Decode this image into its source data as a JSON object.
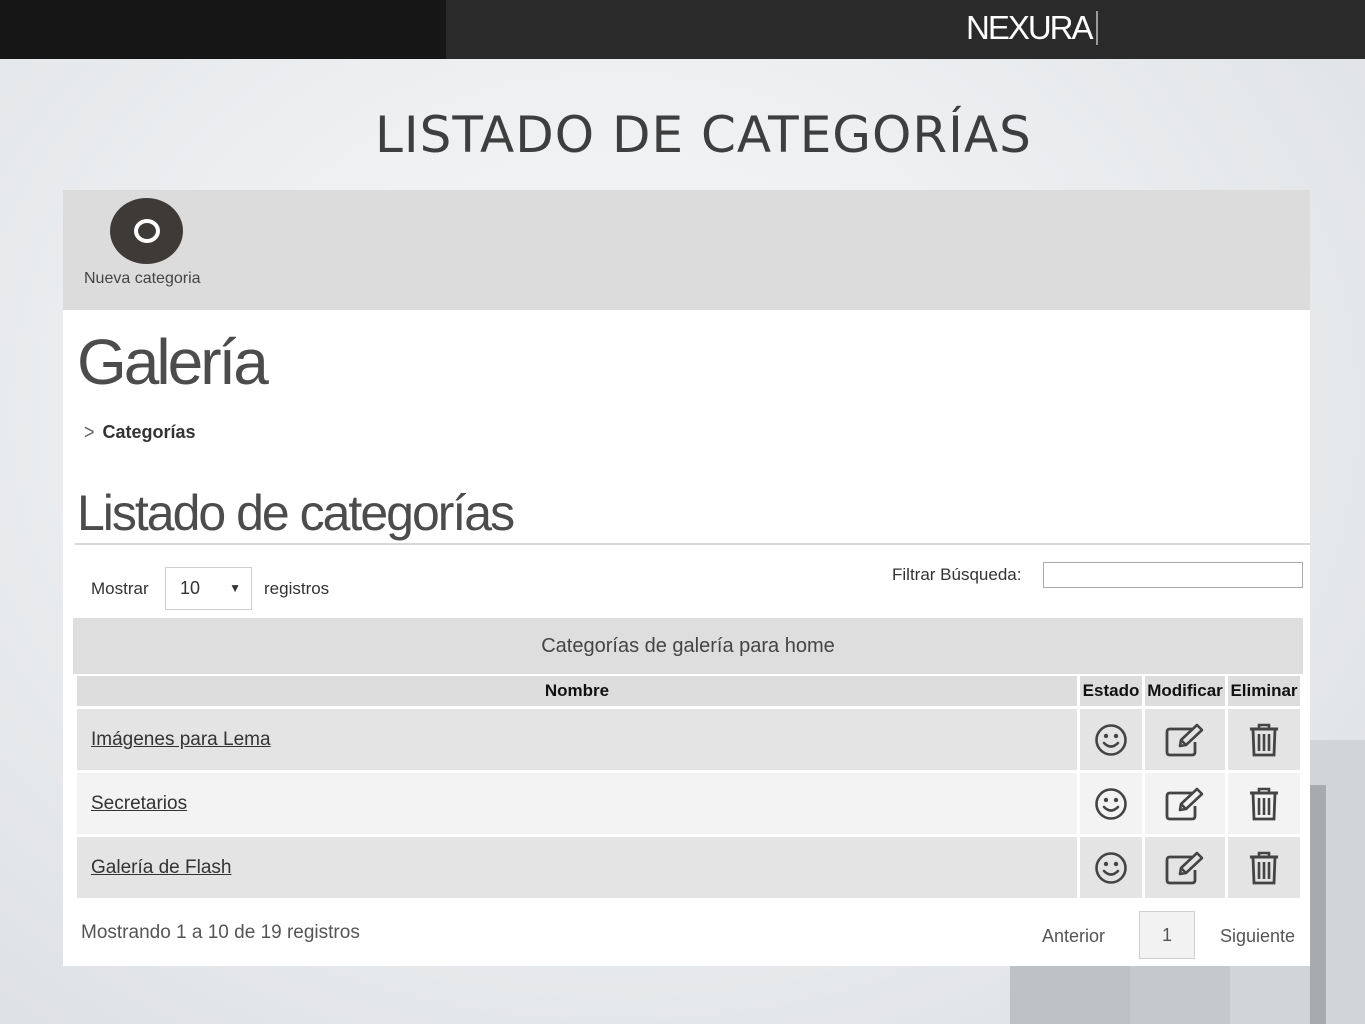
{
  "brand": {
    "logo_text": "NEXURA"
  },
  "slide": {
    "title": "LISTADO DE CATEGORÍAS"
  },
  "toolbar": {
    "new_category_label": "Nueva categoria"
  },
  "page": {
    "module_title": "Galería",
    "breadcrumb": "Categorías",
    "list_title": "Listado de categorías"
  },
  "length_menu": {
    "prefix": "Mostrar",
    "value": "10",
    "suffix": "registros"
  },
  "filter": {
    "label": "Filtrar Búsqueda:",
    "value": ""
  },
  "table": {
    "caption": "Categorías de galería para home",
    "columns": [
      "Nombre",
      "Estado",
      "Modificar",
      "Eliminar"
    ],
    "rows": [
      {
        "name": "Imágenes para Lema",
        "status_icon": "smiley-icon",
        "edit_icon": "edit-icon",
        "delete_icon": "trash-icon"
      },
      {
        "name": "Secretarios",
        "status_icon": "smiley-icon",
        "edit_icon": "edit-icon",
        "delete_icon": "trash-icon"
      },
      {
        "name": "Galería de Flash",
        "status_icon": "smiley-icon",
        "edit_icon": "edit-icon",
        "delete_icon": "trash-icon"
      }
    ]
  },
  "footer": {
    "info": "Mostrando 1 a 10 de 19 registros",
    "prev": "Anterior",
    "current_page": "1",
    "next": "Siguiente"
  },
  "colors": {
    "topbar": "#2a2a2a",
    "toolbar": "#dcdcdc",
    "header_cell": "#dddddd",
    "icon": "#444444"
  }
}
